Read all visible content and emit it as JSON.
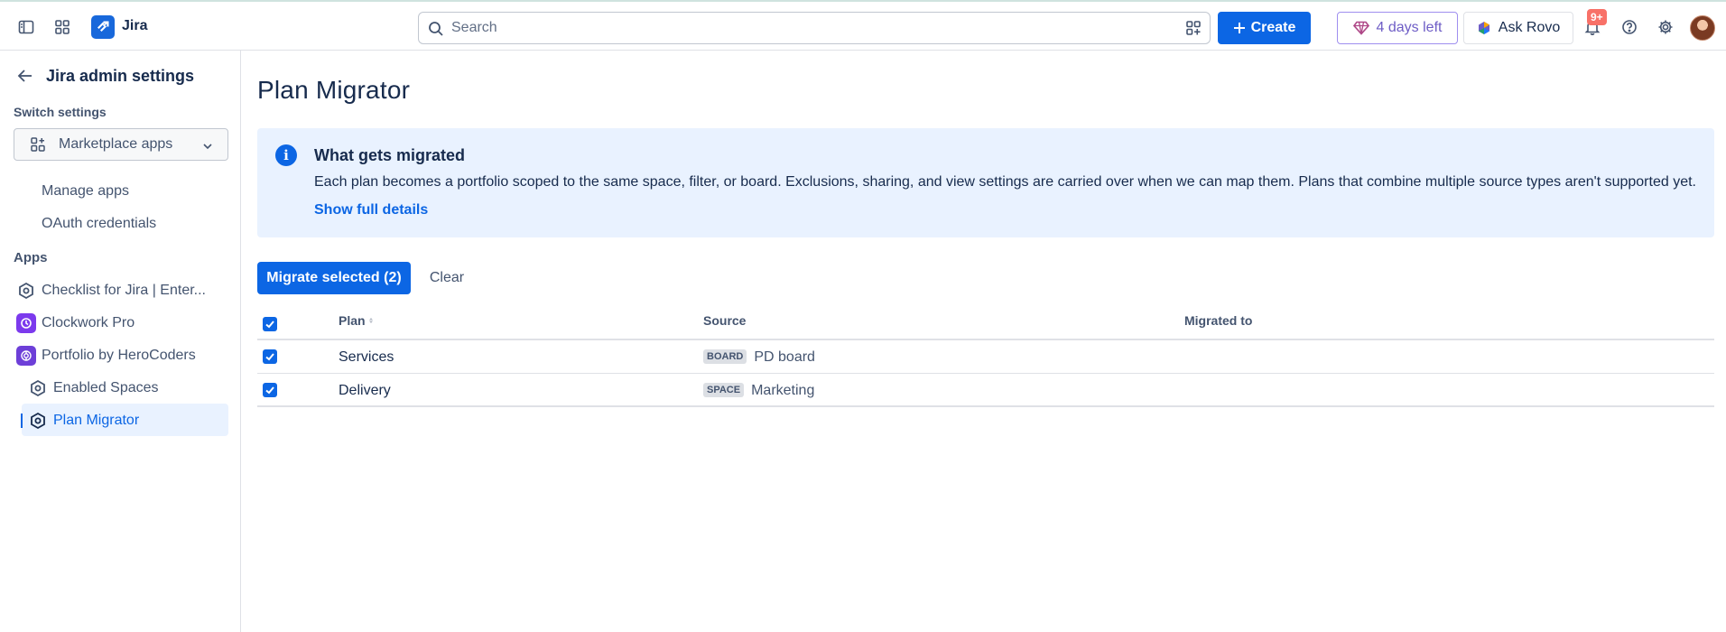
{
  "topbar": {
    "app_name": "Jira",
    "search_placeholder": "Search",
    "create_label": "Create",
    "trial_label": "4 days left",
    "rovo_label": "Ask Rovo",
    "notification_count": "9+"
  },
  "sidebar": {
    "title": "Jira admin settings",
    "switch_settings_label": "Switch settings",
    "switch_value": "Marketplace apps",
    "links": [
      {
        "label": "Manage apps"
      },
      {
        "label": "OAuth credentials"
      }
    ],
    "apps_label": "Apps",
    "apps": [
      {
        "label": "Checklist for Jira | Enter..."
      },
      {
        "label": "Clockwork Pro"
      },
      {
        "label": "Portfolio by HeroCoders"
      }
    ],
    "sub_items": [
      {
        "label": "Enabled Spaces"
      },
      {
        "label": "Plan Migrator"
      }
    ]
  },
  "main": {
    "title": "Plan Migrator",
    "info": {
      "title": "What gets migrated",
      "body": "Each plan becomes a portfolio scoped to the same space, filter, or board. Exclusions, sharing, and view settings are carried over when we can map them. Plans that combine multiple source types aren't supported yet.",
      "link": "Show full details"
    },
    "migrate_button": "Migrate selected (2)",
    "clear_button": "Clear",
    "table": {
      "columns": {
        "plan": "Plan",
        "source": "Source",
        "migrated_to": "Migrated to"
      },
      "rows": [
        {
          "plan": "Services",
          "source_type": "BOARD",
          "source_name": "PD board",
          "migrated_to": ""
        },
        {
          "plan": "Delivery",
          "source_type": "SPACE",
          "source_name": "Marketing",
          "migrated_to": ""
        }
      ]
    }
  },
  "colors": {
    "brand": "#0c66e4",
    "info_bg": "#e9f2ff",
    "trial": "#6e5dc6",
    "badge": "#f87168"
  }
}
